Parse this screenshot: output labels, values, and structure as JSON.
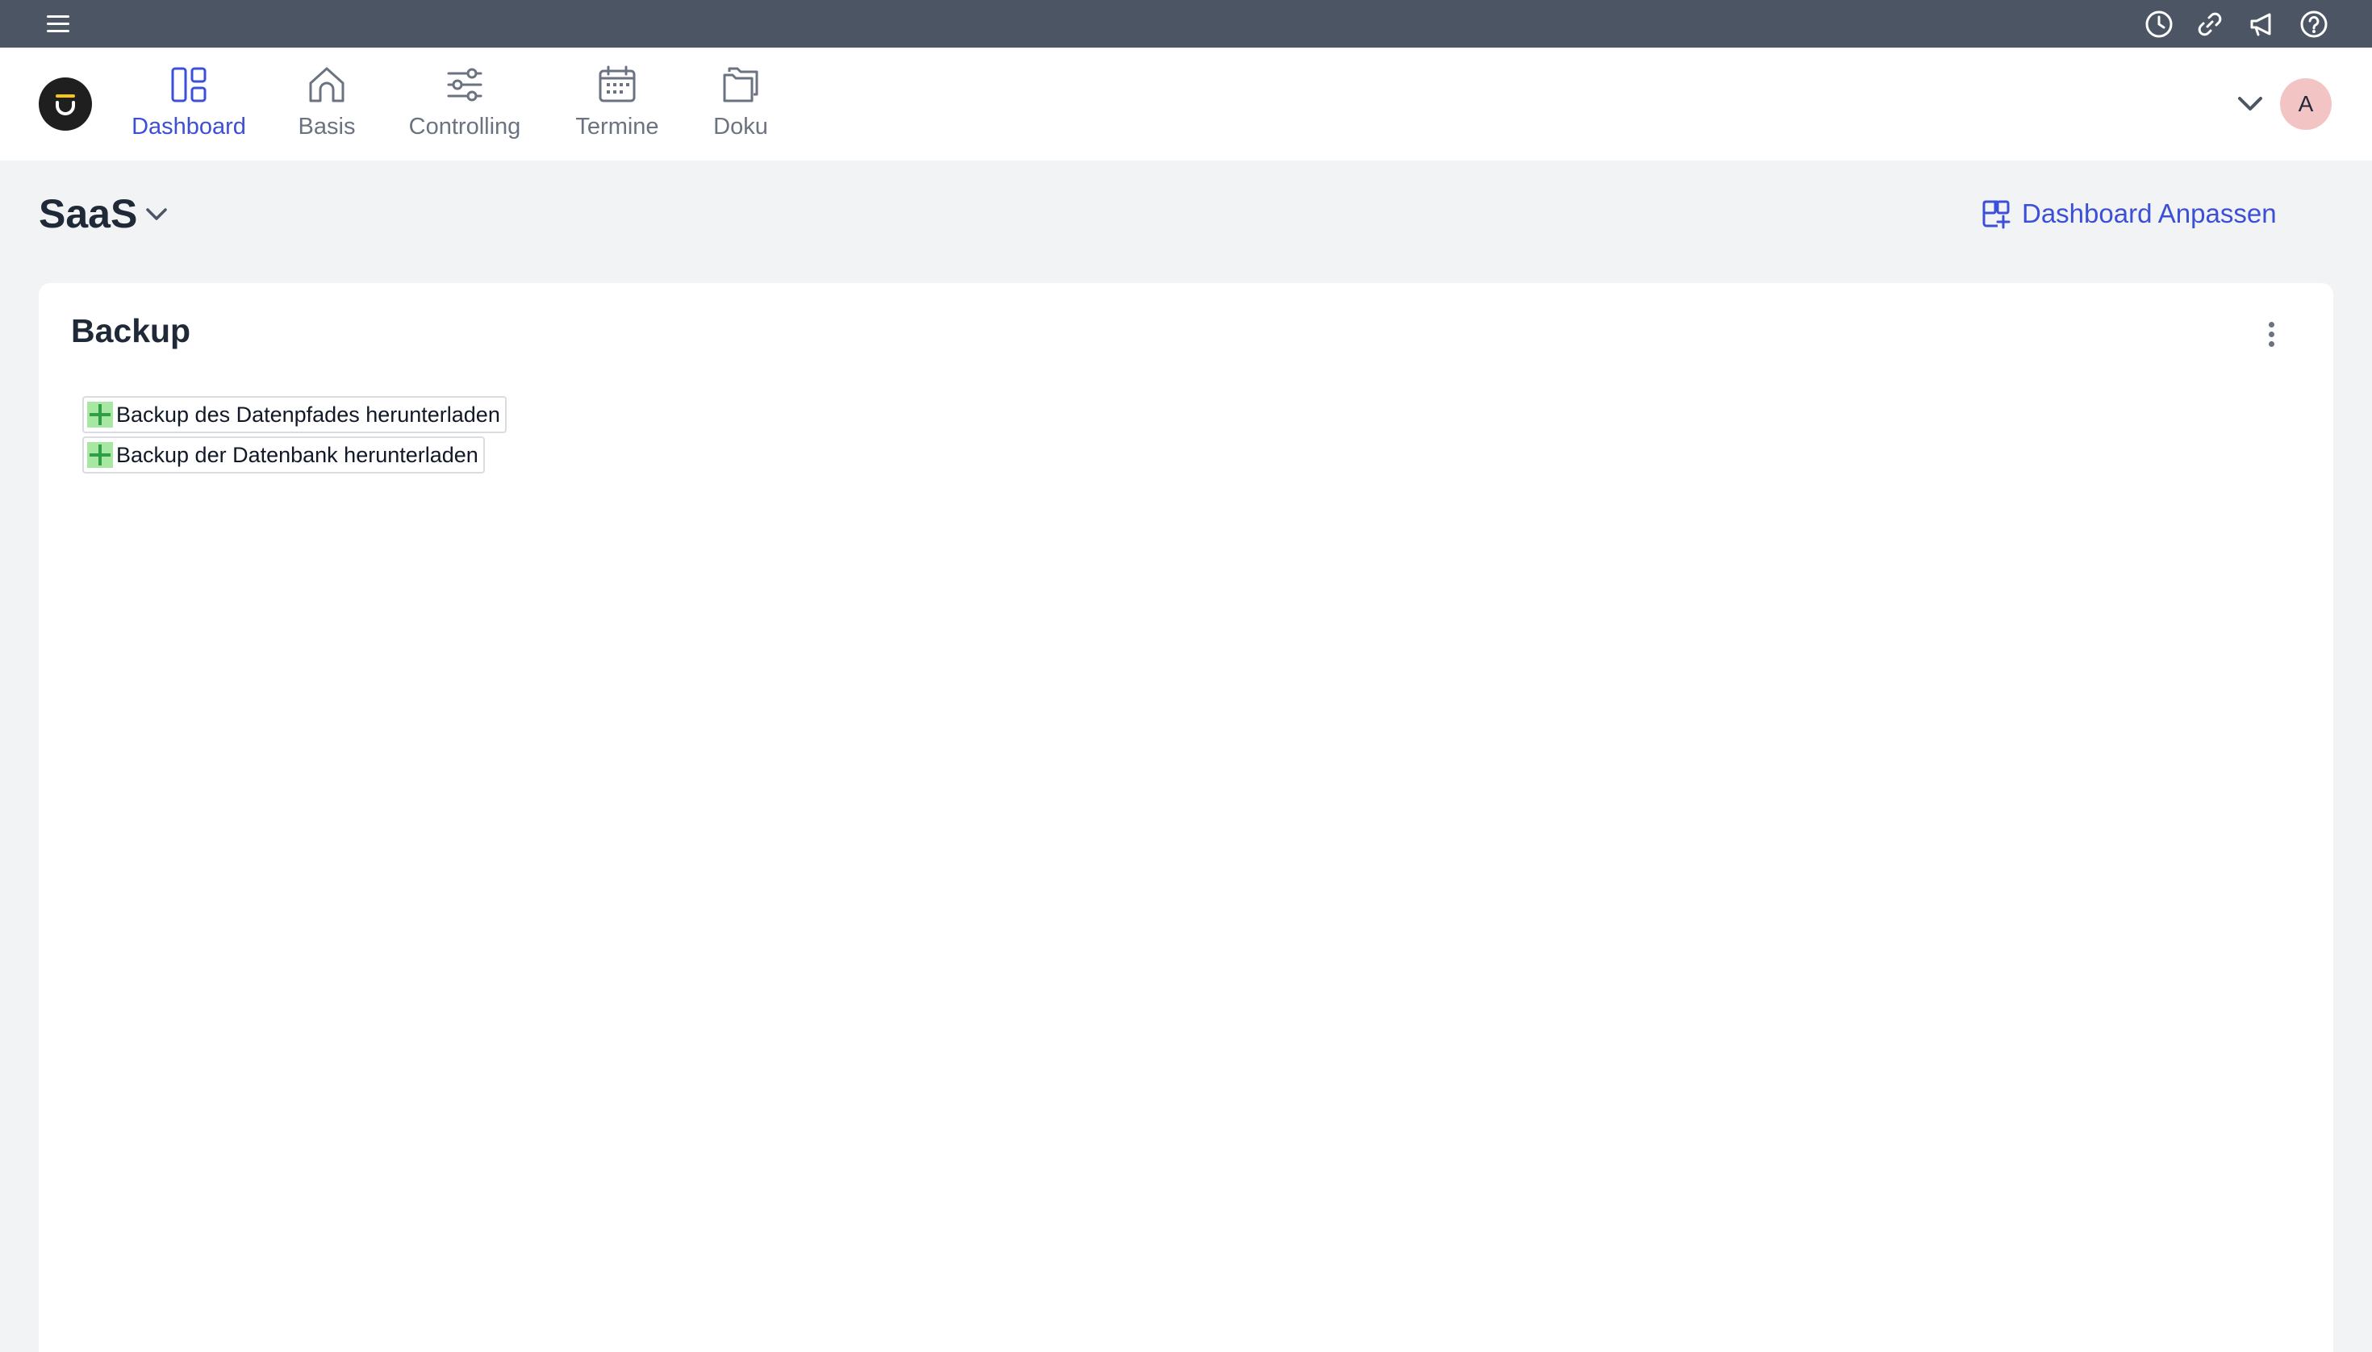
{
  "topbar": {
    "icons": [
      "menu-icon",
      "clock-icon",
      "link-icon",
      "megaphone-icon",
      "help-icon"
    ]
  },
  "nav": {
    "items": [
      {
        "label": "Dashboard",
        "icon": "dashboard-icon",
        "active": true
      },
      {
        "label": "Basis",
        "icon": "home-icon",
        "active": false
      },
      {
        "label": "Controlling",
        "icon": "sliders-icon",
        "active": false
      },
      {
        "label": "Termine",
        "icon": "calendar-icon",
        "active": false
      },
      {
        "label": "Doku",
        "icon": "folders-icon",
        "active": false
      }
    ],
    "avatar_initial": "A"
  },
  "page": {
    "title": "SaaS",
    "customize_label": "Dashboard Anpassen"
  },
  "card": {
    "title": "Backup",
    "actions": [
      {
        "label": "Backup des Datenpfades herunterladen"
      },
      {
        "label": "Backup der Datenbank herunterladen"
      }
    ]
  },
  "colors": {
    "topbar": "#4b5563",
    "accent": "#3b4fd8",
    "background": "#f2f3f5",
    "avatar": "#f3c4c4",
    "plus_icon": "#a8e6a3"
  }
}
